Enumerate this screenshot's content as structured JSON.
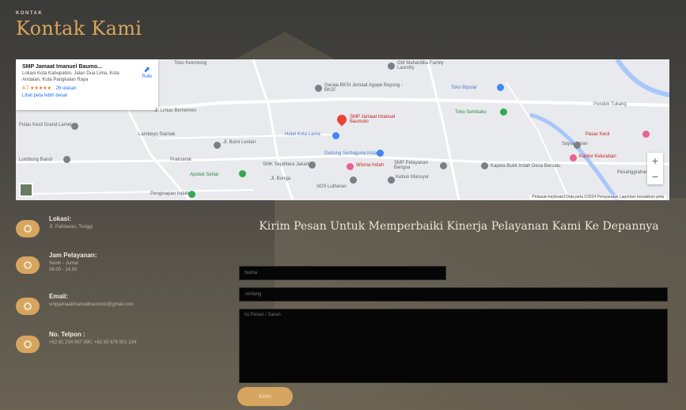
{
  "header": {
    "kicker": "KONTAK",
    "title": "Kontak Kami"
  },
  "map": {
    "card": {
      "title": "SMP Jamaat Imanuel Baumo...",
      "address": "Lokasi Kota Kabupaten, Jalan Dua Lima, Kota Andalan, Kota Pangkalan Raya",
      "rating": "4.7 ★★★★★",
      "reviews": "26 ulasan",
      "link": "Lihat peta lebih besar",
      "route_label": "Rute"
    },
    "labels": [
      "Toko Kelontong",
      "GM Mahardika Family Laundry",
      "Geraja BKSI Jemaat Agape Bayung - BKSI",
      "Toko Bipolar",
      "Jl. Lintas Bernemen",
      "SMP Jamaat Imanuel Baumolo",
      "Toko Sembako",
      "Pondok Tukang",
      "Pulau Kecil Grand Lamel",
      "Lambeyo Siamak",
      "Hotel Kota Lama",
      "Pasar Kecil",
      "Sayur Aman",
      "Jl. Bumi Lestari",
      "Gedung Serbaguna Kota",
      "Lumbung Bandi",
      "Praksarak",
      "SMK Sejahtera Jakarta",
      "Wisma Indah",
      "SMP Pelayanan Bangsa",
      "Kapela Bukit Indah Desa Bersatu",
      "Kantor Kelurahan",
      "Apotek Sehat",
      "Jl. Bunga",
      "Kebun Mansyur",
      "Penginapan Indah",
      "Pesanggrahan Umum",
      "SDS Lutheran"
    ],
    "footer": "Pintasan keyboard   Data peta ©2024   Persyaratan   Laporkan kesalahan peta",
    "zoom_in": "+",
    "zoom_out": "−"
  },
  "info": [
    {
      "icon": "location-icon",
      "label": "Lokasi:",
      "value": "Jl. Pahlawan, Tonggi"
    },
    {
      "icon": "clock-icon",
      "label": "Jam Pelayanan:",
      "value": "Senin - Jumat\n08.00 - 14.00"
    },
    {
      "icon": "email-icon",
      "label": "Email:",
      "value": "smpjamaatimanuelbaumolo@gmail.com"
    },
    {
      "icon": "phone-icon",
      "label": "No. Telpon :",
      "value": "+62 81 234 567 890, +62 85 678 901 234"
    }
  ],
  "form": {
    "title": "Kirim Pesan Untuk Memperbaiki Kinerja Pelayanan Kami Ke Depannya",
    "name_placeholder": "Nama",
    "subject_placeholder": "Tentang",
    "message_placeholder": "Isi Pesan / Saran",
    "send_label": "Kirim"
  },
  "colors": {
    "accent": "#d6a560",
    "title": "#d9a65a",
    "field_bg": "#060606"
  }
}
